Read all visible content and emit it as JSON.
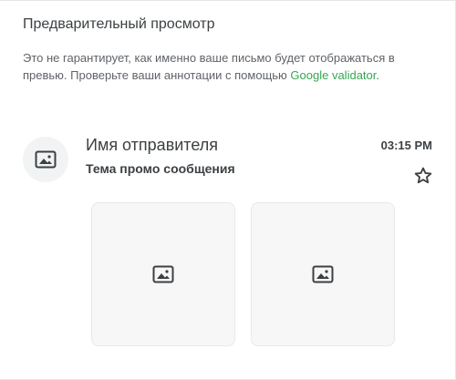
{
  "preview": {
    "title": "Предварительный просмотр",
    "description_text": "Это не гарантирует, как именно ваше письмо будет отображаться в превью. Проверьте ваши аннотации с помощью ",
    "link_text": "Google validator",
    "description_end": ".",
    "link_color": "#34a853"
  },
  "email": {
    "sender": "Имя отправителя",
    "subject": "Тема промо сообщения",
    "time": "03:15 PM",
    "avatar_icon": "image-icon",
    "star_icon": "star-outline-icon"
  },
  "images": [
    {
      "icon": "image-icon"
    },
    {
      "icon": "image-icon"
    }
  ]
}
